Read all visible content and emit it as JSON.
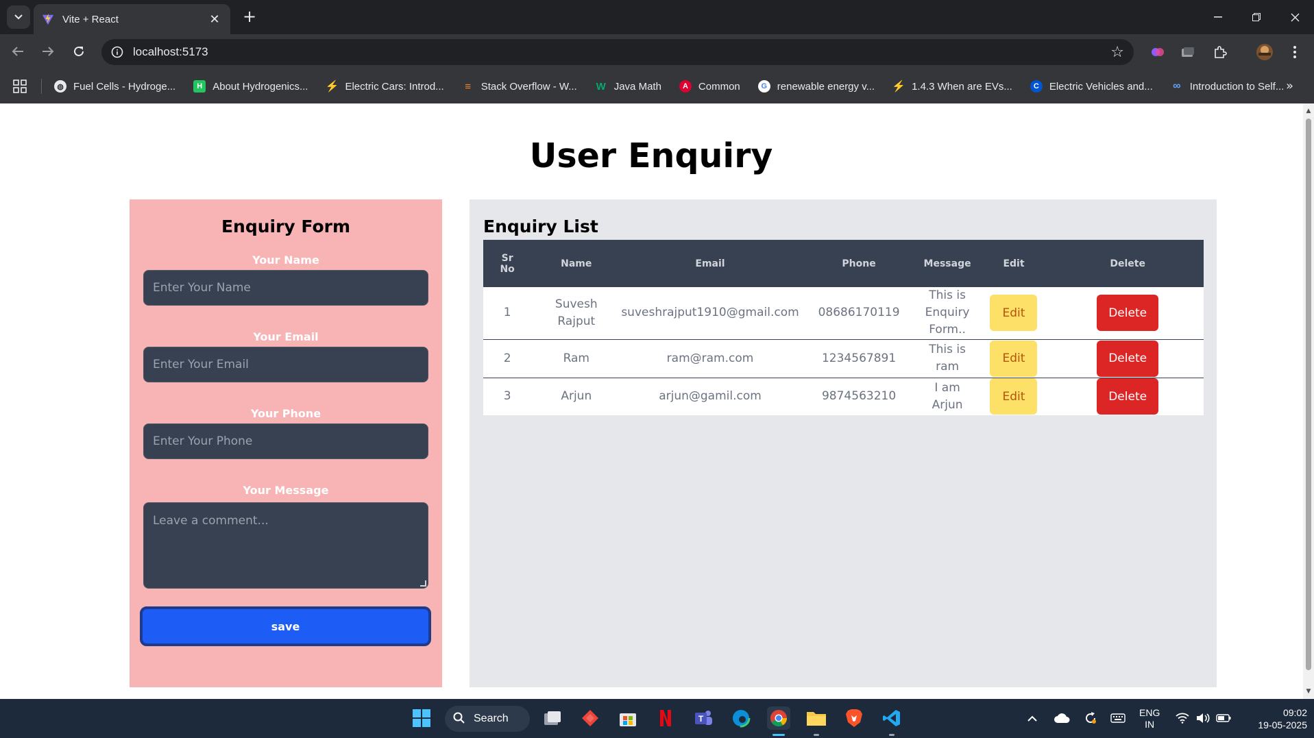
{
  "browser": {
    "tab_title": "Vite + React",
    "url": "localhost:5173",
    "bookmarks": [
      {
        "label": "Fuel Cells - Hydroge...",
        "icon": "globe-icon"
      },
      {
        "label": "About Hydrogenics...",
        "icon": "hydrogenics-icon"
      },
      {
        "label": "Electric Cars: Introd...",
        "icon": "bolt-icon"
      },
      {
        "label": "Stack Overflow - W...",
        "icon": "stackoverflow-icon"
      },
      {
        "label": "Java Math",
        "icon": "w3schools-icon"
      },
      {
        "label": "Common",
        "icon": "angular-icon"
      },
      {
        "label": "renewable energy v...",
        "icon": "google-icon"
      },
      {
        "label": "1.4.3 When are EVs...",
        "icon": "bolt-icon"
      },
      {
        "label": "Electric Vehicles and...",
        "icon": "coursera-icon"
      },
      {
        "label": "Introduction to Self...",
        "icon": "infinity-icon"
      }
    ]
  },
  "page": {
    "title": "User Enquiry"
  },
  "form": {
    "heading": "Enquiry Form",
    "name_label": "Your Name",
    "name_placeholder": "Enter Your Name",
    "email_label": "Your Email",
    "email_placeholder": "Enter Your Email",
    "phone_label": "Your Phone",
    "phone_placeholder": "Enter Your Phone",
    "message_label": "Your Message",
    "message_placeholder": "Leave a comment...",
    "save_label": "save"
  },
  "list": {
    "heading": "Enquiry List",
    "columns": {
      "sr_line1": "Sr",
      "sr_line2": "No",
      "name": "Name",
      "email": "Email",
      "phone": "Phone",
      "message": "Message",
      "edit": "Edit",
      "delete": "Delete"
    },
    "rows": [
      {
        "sr": "1",
        "name_line1": "Suvesh",
        "name_line2": "Rajput",
        "email": "suveshrajput1910@gmail.com",
        "phone": "08686170119",
        "msg_line1": "This is",
        "msg_line2": "Enquiry",
        "msg_line3": "Form..",
        "edit": "Edit",
        "delete": "Delete"
      },
      {
        "sr": "2",
        "name_line1": "Ram",
        "email": "ram@ram.com",
        "phone": "1234567891",
        "msg_line1": "This is",
        "msg_line2": "ram",
        "edit": "Edit",
        "delete": "Delete"
      },
      {
        "sr": "3",
        "name_line1": "Arjun",
        "email": "arjun@gamil.com",
        "phone": "9874563210",
        "msg_line1": "I am",
        "msg_line2": "Arjun",
        "edit": "Edit",
        "delete": "Delete"
      }
    ]
  },
  "taskbar": {
    "search_label": "Search",
    "lang_line1": "ENG",
    "lang_line2": "IN",
    "time": "09:02",
    "date": "19-05-2025"
  },
  "colors": {
    "form_bg": "#f8b4b4",
    "list_bg": "#e5e7eb",
    "input_bg": "#374151",
    "save_btn": "#1d5cf5",
    "edit_btn": "#fde068",
    "delete_btn": "#dc2626"
  }
}
